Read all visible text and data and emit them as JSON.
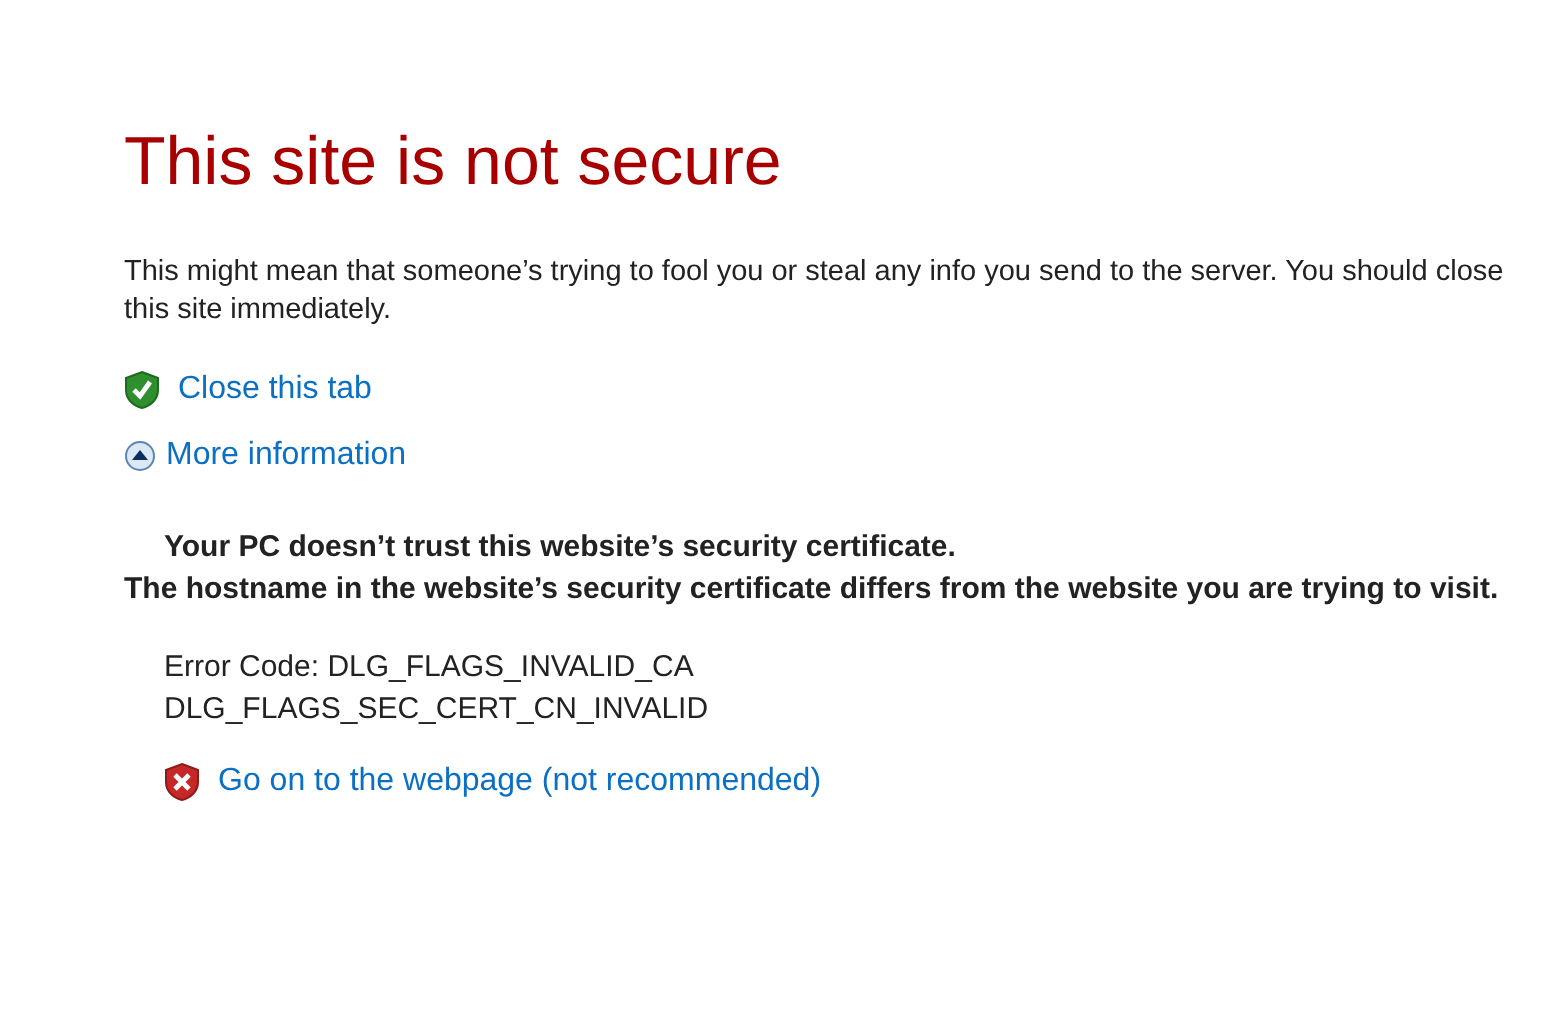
{
  "title": "This site is not secure",
  "message": "This might mean that someone’s trying to fool you or steal any info you send to the server. You should close this site immediately.",
  "close_link": "Close this tab",
  "more_info": {
    "label": "More information",
    "expanded": true
  },
  "details": {
    "heading": "Your PC doesn’t trust this website’s security certificate.",
    "explanation": "The hostname in the website’s security certificate differs from the website you are trying to visit.",
    "error_lines": [
      "Error Code: DLG_FLAGS_INVALID_CA",
      "DLG_FLAGS_SEC_CERT_CN_INVALID"
    ],
    "proceed_link": "Go on to the webpage (not recommended)"
  }
}
